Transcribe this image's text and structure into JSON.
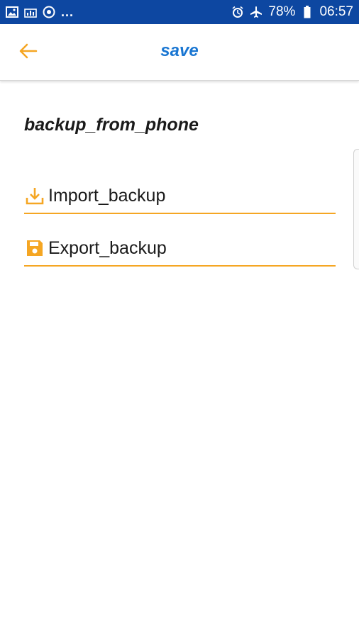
{
  "status_bar": {
    "left_icons": [
      "image-icon",
      "chart-icon",
      "chrome-icon"
    ],
    "overflow": "...",
    "right_icons": [
      "alarm-icon",
      "airplane-icon",
      "battery-icon"
    ],
    "battery": "78%",
    "time": "06:57"
  },
  "app_bar": {
    "back_icon": "arrow-back-icon",
    "title": "save"
  },
  "section": {
    "title": "backup_from_phone"
  },
  "options": [
    {
      "icon": "download-icon",
      "label": "Import_backup"
    },
    {
      "icon": "save-icon",
      "label": "Export_backup"
    }
  ],
  "colors": {
    "status_bar": "#0d47a1",
    "accent": "#f5a623",
    "title": "#1976d2"
  }
}
